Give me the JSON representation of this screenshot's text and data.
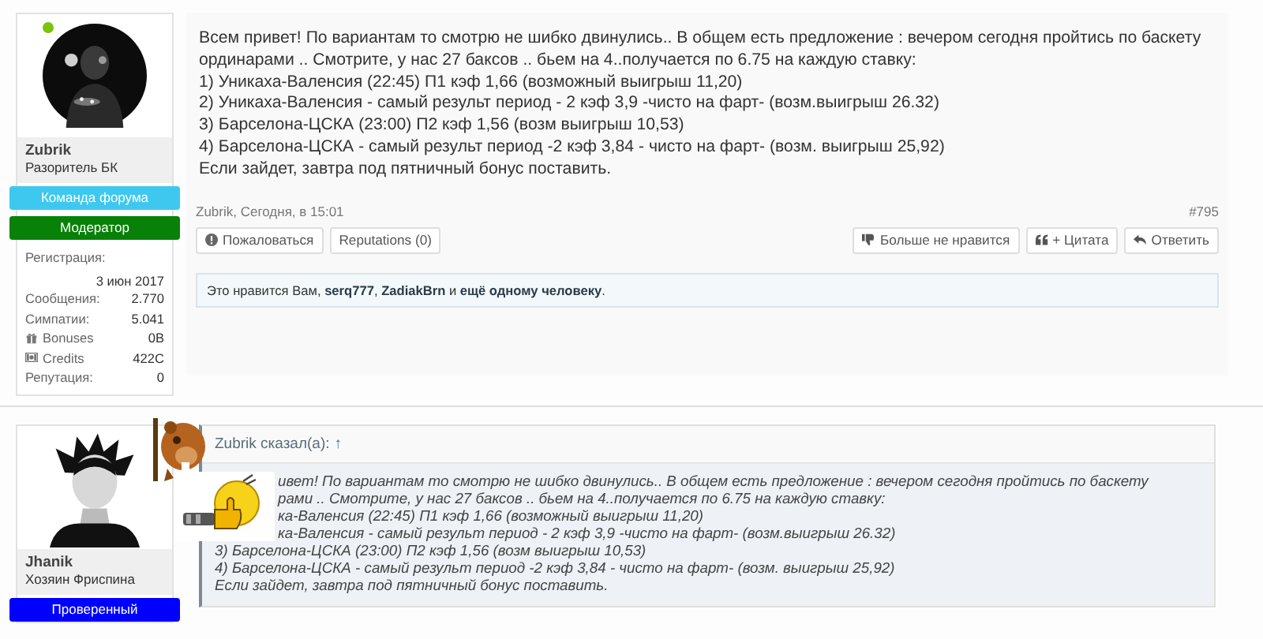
{
  "posts": [
    {
      "author": {
        "name": "Zubrik",
        "title": "Разоритель БК",
        "online": true,
        "avatar": {
          "kind": "round"
        },
        "banners": [
          {
            "label": "Команда форума",
            "color": "#3ec8f0"
          },
          {
            "label": "Модератор",
            "color": "#078107"
          }
        ],
        "stats": [
          {
            "label": "Регистрация:",
            "value": "3 июн 2017",
            "kind": "stacked"
          },
          {
            "label": "Сообщения:",
            "value": "2.770",
            "kind": "plain"
          },
          {
            "label": "Симпатии:",
            "value": "5.041",
            "kind": "plain"
          },
          {
            "label": "Bonuses",
            "value": "0B",
            "kind": "bonus"
          },
          {
            "label": "Credits",
            "value": "422C",
            "kind": "credit"
          },
          {
            "label": "Репутация:",
            "value": "0",
            "kind": "plain"
          }
        ]
      },
      "message": {
        "lines": [
          "Всем привет! По вариантам то смотрю не шибко двинулись.. В общем есть предложение : вечером сегодня пройтись по баскету",
          "ординарами .. Смотрите, у нас 27 баксов .. бьем на 4..получается по 6.75 на каждую ставку:",
          "1) Уникаха-Валенсия (22:45) П1 кэф 1,66 (возможный выигрыш 11,20)",
          "2) Уникаха-Валенсия - самый результ период - 2 кэф 3,9 -чисто на фарт- (возм.выигрыш 26.32)",
          "3) Барселона-ЦСКА (23:00) П2 кэф 1,56 (возм выигрыш 10,53)",
          "4) Барселона-ЦСКА - самый результ период -2 кэф 3,84 - чисто на фарт- (возм. выигрыш 25,92)",
          "Если зайдет, завтра под пятничный бонус поставить."
        ]
      },
      "byline": "Zubrik, Сегодня, в 15:01",
      "number": "#795",
      "actions_left": [
        {
          "label": "Пожаловаться",
          "kind": "report"
        },
        {
          "label": "Reputations (0)",
          "kind": "plain"
        }
      ],
      "actions_right": [
        {
          "label": "Больше не нравится",
          "kind": "unlike"
        },
        {
          "label": "+ Цитата",
          "kind": "quote"
        },
        {
          "label": "Ответить",
          "kind": "reply"
        }
      ],
      "likes": "Это нравится Вам, **serq777**, **ZadiakBrn** и **ещё одному человеку**."
    },
    {
      "author": {
        "name": "Jhanik",
        "title": "Хозяин Фриспина",
        "avatar": {
          "kind": "square"
        },
        "banners": [
          {
            "label": "Проверенный",
            "color": "#0000ff"
          }
        ]
      },
      "quote": {
        "author": "Zubrik сказал(а):",
        "link": "↑",
        "lines": [
          "ивет! По вариантам то смотрю не шибко двинулись.. В общем есть предложение : вечером сегодня пройтись по баскету",
          "рами .. Смотрите, у нас 27 баксов .. бьем на 4..получается по 6.75 на каждую ставку:",
          "ка-Валенсия (22:45) П1 кэф 1,66 (возможный выигрыш 11,20)",
          "ка-Валенсия - самый результ период - 2 кэф 3,9 -чисто на фарт- (возм.выигрыш 26.32)",
          "3) Барселона-ЦСКА (23:00) П2 кэф 1,56 (возм выигрыш 10,53)",
          "4) Барселона-ЦСКА - самый результ период -2 кэф 3,84 - чисто на фарт- (возм. выигрыш 25,92)",
          "Если зайдет, завтра под пятничный бонус поставить."
        ]
      }
    }
  ]
}
